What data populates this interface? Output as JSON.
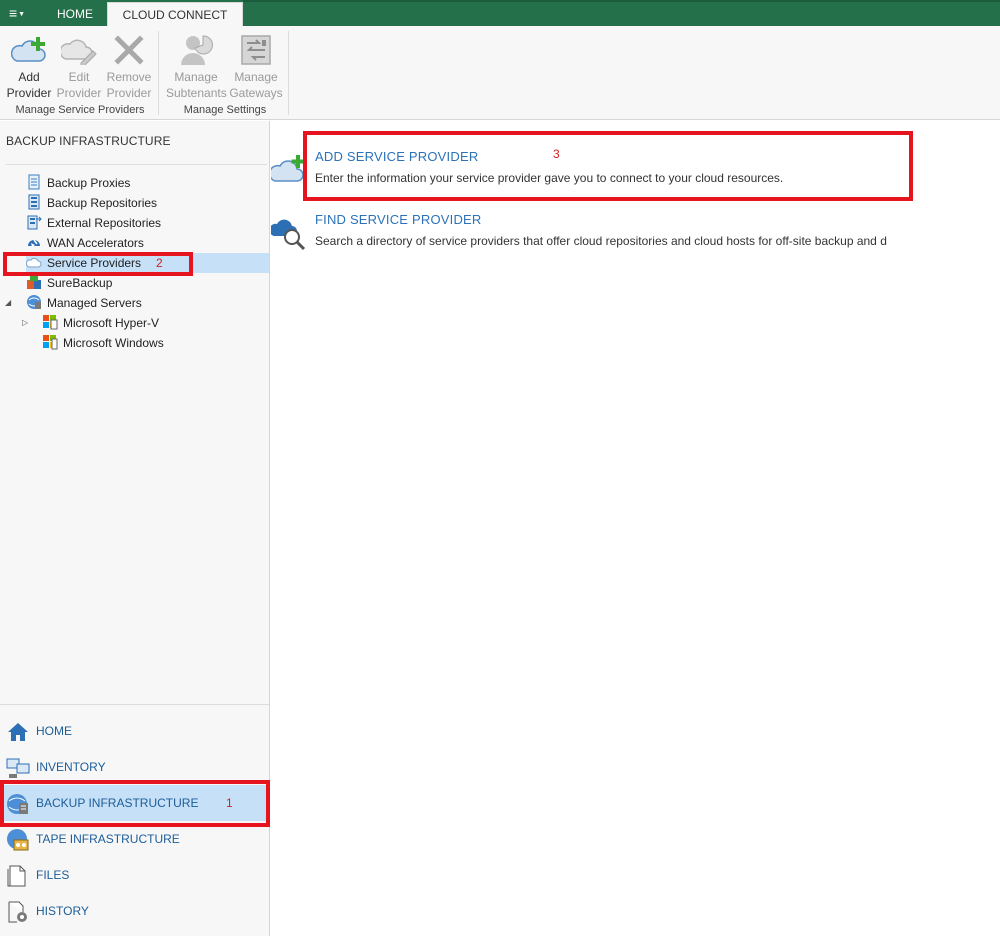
{
  "titlebar": {
    "menu_icon": "hamburger-menu-icon",
    "tabs": [
      {
        "label": "HOME",
        "active": false
      },
      {
        "label": "CLOUD CONNECT",
        "active": true
      }
    ]
  },
  "ribbon": {
    "groups": [
      {
        "label": "Manage Service Providers",
        "buttons": [
          {
            "line1": "Add",
            "line2": "Provider",
            "icon": "cloud-add-icon",
            "enabled": true
          },
          {
            "line1": "Edit",
            "line2": "Provider",
            "icon": "cloud-edit-icon",
            "enabled": false
          },
          {
            "line1": "Remove",
            "line2": "Provider",
            "icon": "remove-x-icon",
            "enabled": false
          }
        ]
      },
      {
        "label": "Manage Settings",
        "buttons": [
          {
            "line1": "Manage",
            "line2": "Subtenants",
            "icon": "user-pie-icon",
            "enabled": false
          },
          {
            "line1": "Manage",
            "line2": "Gateways",
            "icon": "gateway-icon",
            "enabled": false
          }
        ]
      }
    ]
  },
  "leftpane": {
    "title": "BACKUP INFRASTRUCTURE",
    "tree": [
      {
        "label": "Backup Proxies",
        "icon": "backup-proxy-icon"
      },
      {
        "label": "Backup Repositories",
        "icon": "backup-repository-icon"
      },
      {
        "label": "External Repositories",
        "icon": "external-repository-icon"
      },
      {
        "label": "WAN Accelerators",
        "icon": "wan-accelerator-icon"
      },
      {
        "label": "Service Providers",
        "icon": "cloud-provider-icon",
        "selected": true
      },
      {
        "label": "SureBackup",
        "icon": "surebackup-icon"
      },
      {
        "label": "Managed Servers",
        "icon": "managed-servers-icon",
        "expanded": true
      },
      {
        "label": "Microsoft Hyper-V",
        "icon": "hyperv-icon",
        "collapsed": true
      },
      {
        "label": "Microsoft Windows",
        "icon": "windows-server-icon"
      }
    ],
    "nav": [
      {
        "label": "HOME",
        "icon": "home-icon"
      },
      {
        "label": "INVENTORY",
        "icon": "inventory-icon"
      },
      {
        "label": "BACKUP INFRASTRUCTURE",
        "icon": "backup-infrastructure-icon",
        "selected": true
      },
      {
        "label": "TAPE INFRASTRUCTURE",
        "icon": "tape-icon"
      },
      {
        "label": "FILES",
        "icon": "files-icon"
      },
      {
        "label": "HISTORY",
        "icon": "history-icon"
      }
    ]
  },
  "main": {
    "actions": [
      {
        "title": "ADD SERVICE PROVIDER",
        "description": "Enter the information your service provider gave you to connect to your cloud resources.",
        "icon": "cloud-add-icon"
      },
      {
        "title": "FIND SERVICE PROVIDER",
        "description": "Search a directory of service providers that offer cloud repositories and cloud hosts for off-site backup and d",
        "icon": "cloud-search-icon"
      }
    ]
  },
  "annotations": {
    "step1": "1",
    "step2": "2",
    "step3": "3",
    "color": "#e5141f"
  },
  "colors": {
    "tab_bar": "#24704a",
    "link_blue": "#2b72b9",
    "selection": "#c5e0f7",
    "pane_bg": "#f7f7f7"
  }
}
